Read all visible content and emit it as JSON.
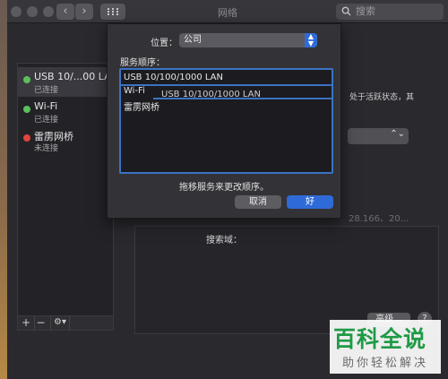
{
  "window": {
    "title": "网络",
    "search_placeholder": "搜索"
  },
  "sidebar": {
    "items": [
      {
        "name": "USB 10/...00 LAN",
        "state": "已连接",
        "status_color": "#5ac05a",
        "selected": true
      },
      {
        "name": "Wi-Fi",
        "state": "已连接",
        "status_color": "#5ac05a",
        "selected": false
      },
      {
        "name": "雷雳网桥",
        "state": "未连接",
        "status_color": "#e0443c",
        "selected": false
      }
    ],
    "toolbar": {
      "add": "+",
      "remove": "−",
      "gear": "⚙▾"
    }
  },
  "background": {
    "status_text_fragment": "处于活跃状态，其",
    "ip_fragment": "28.166、20...",
    "search_domain_label": "搜索域：",
    "advanced_button": "高级...",
    "help_button": "?"
  },
  "sheet": {
    "location_label": "位置：",
    "location_value": "公司",
    "order_label": "服务顺序：",
    "order_items": [
      "USB 10/100/1000 LAN",
      "Wi-Fi",
      "雷雳网桥"
    ],
    "drag_ghost": "USB 10/100/1000 LAN",
    "hint": "拖移服务来更改顺序。",
    "cancel_button": "取消",
    "ok_button": "好"
  },
  "watermark": {
    "main": "百科全说",
    "sub": "助你轻松解决"
  },
  "colors": {
    "accent": "#2f6bd8",
    "connected": "#5ac05a",
    "disconnected": "#e0443c",
    "watermark_green": "#1f9a46"
  }
}
